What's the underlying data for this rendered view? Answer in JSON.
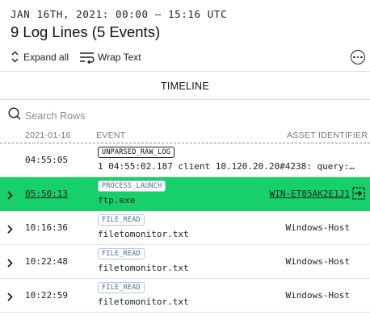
{
  "header": {
    "time_range": "JAN 16TH, 2021: 00:00 – 15:16 UTC",
    "title": "9 Log Lines (5 Events)"
  },
  "toolbar": {
    "expand_label": "Expand all",
    "wrap_label": "Wrap Text",
    "more_icon": "ellipsis-circle-icon"
  },
  "tabs": {
    "timeline": "TIMELINE"
  },
  "search": {
    "placeholder": "Search Rows"
  },
  "columns": {
    "date": "2021-01-16",
    "event": "EVENT",
    "asset": "ASSET IDENTIFIER"
  },
  "rows": [
    {
      "time": "04:55:05",
      "badge": "UNPARSED_RAW_LOG",
      "event": "1 04:55:02.187 client 10.120.20.20#4238: query:…",
      "asset": ""
    },
    {
      "time": "05:50:13",
      "badge": "PROCESS_LAUNCH",
      "event": "ftp.exe",
      "asset": "WIN-ET85AK2E1J1"
    },
    {
      "time": "10:16:36",
      "badge": "FILE_READ",
      "event": "filetomonitor.txt",
      "asset": "Windows-Host"
    },
    {
      "time": "10:22:48",
      "badge": "FILE_READ",
      "event": "filetomonitor.txt",
      "asset": "Windows-Host"
    },
    {
      "time": "10:22:59",
      "badge": "FILE_READ",
      "event": "filetomonitor.txt",
      "asset": "Windows-Host"
    }
  ],
  "colors": {
    "selected_row": "#17d06a",
    "badge_border": "#b9c8d8",
    "badge_text": "#4f6f92"
  }
}
